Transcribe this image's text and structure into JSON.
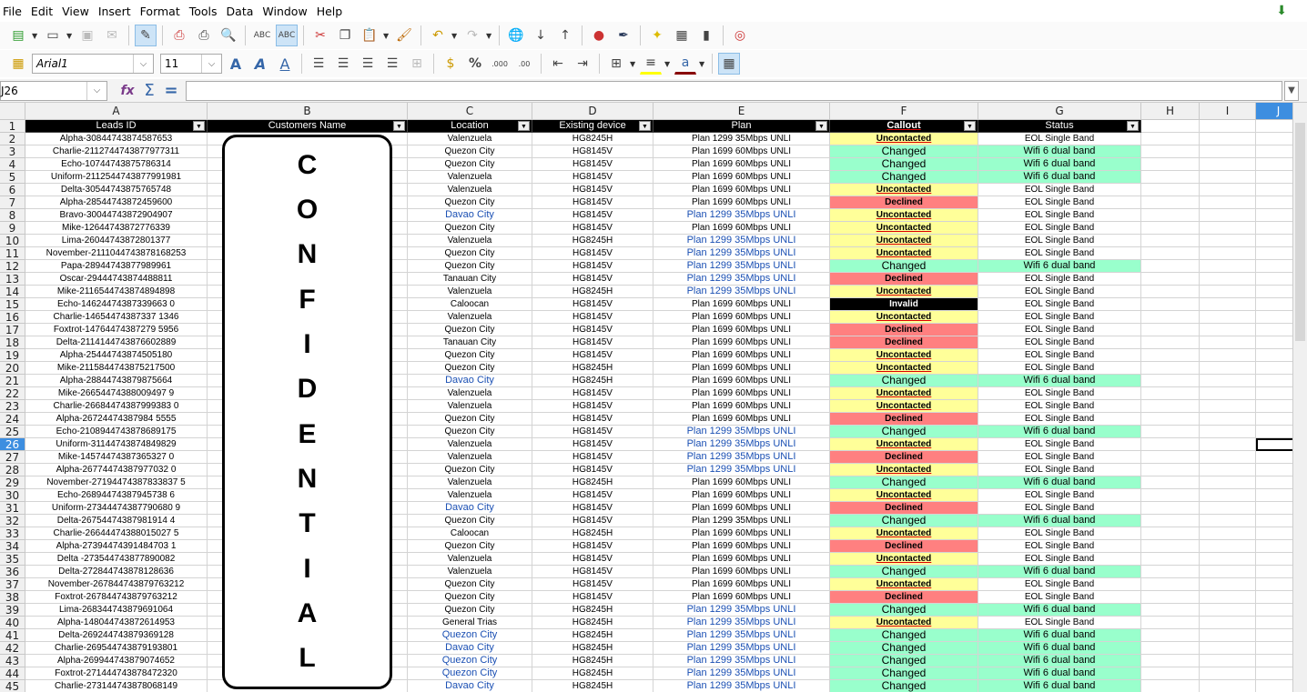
{
  "menu": [
    "File",
    "Edit",
    "View",
    "Insert",
    "Format",
    "Tools",
    "Data",
    "Window",
    "Help"
  ],
  "font_name": "Arial1",
  "font_size": "11",
  "name_box": "J26",
  "formula": "",
  "columns": [
    "A",
    "B",
    "C",
    "D",
    "E",
    "F",
    "G",
    "H",
    "I",
    "J"
  ],
  "selected_cell": {
    "col": "J",
    "row": 26
  },
  "headers": [
    "Leads ID",
    "Customers Name",
    "Location",
    "Existing device",
    "Plan",
    "Callout",
    "Status"
  ],
  "watermark": "CONFIDENTIAL",
  "rows": [
    [
      "Alpha-30844743874587653",
      "Valenzuela",
      "HG8245H",
      "Plan 1299 35Mbps UNLI",
      "Uncontacted",
      "EOL Single Band"
    ],
    [
      "Charlie-2112744743877977311",
      "Quezon City",
      "HG8145V",
      "Plan 1699 60Mbps UNLI",
      "Changed",
      "Wifi 6 dual band"
    ],
    [
      "Echo-10744743875786314",
      "Quezon City",
      "HG8145V",
      "Plan 1699 60Mbps UNLI",
      "Changed",
      "Wifi 6 dual band"
    ],
    [
      "Uniform-2112544743877991981",
      "Valenzuela",
      "HG8145V",
      "Plan 1699 60Mbps UNLI",
      "Changed",
      "Wifi 6 dual band"
    ],
    [
      "Delta-30544743875765748",
      "Valenzuela",
      "HG8145V",
      "Plan 1699 60Mbps UNLI",
      "Uncontacted",
      "EOL Single Band"
    ],
    [
      "Alpha-28544743872459600",
      "Quezon City",
      "HG8145V",
      "Plan 1699 60Mbps UNLI",
      "Declined",
      "EOL Single Band"
    ],
    [
      "Bravo-30044743872904907",
      "Davao City",
      "HG8145V",
      "Plan 1299 35Mbps UNLI",
      "Uncontacted",
      "EOL Single Band"
    ],
    [
      "Mike-12644743872776339",
      "Quezon City",
      "HG8145V",
      "Plan 1699 60Mbps UNLI",
      "Uncontacted",
      "EOL Single Band"
    ],
    [
      "Lima-26044743872801377",
      "Valenzuela",
      "HG8245H",
      "Plan 1299 35Mbps UNLI",
      "Uncontacted",
      "EOL Single Band"
    ],
    [
      "November-2111044743878168253",
      "Quezon City",
      "HG8145V",
      "Plan 1299 35Mbps UNLI",
      "Uncontacted",
      "EOL Single Band"
    ],
    [
      "Papa-28944743877989961",
      "Quezon City",
      "HG8145V",
      "Plan 1299 35Mbps UNLI",
      "Changed",
      "Wifi 6 dual band"
    ],
    [
      "Oscar-29444743874488811",
      "Tanauan City",
      "HG8145V",
      "Plan 1299 35Mbps UNLI",
      "Declined",
      "EOL Single Band"
    ],
    [
      "Mike-2116544743874894898",
      "Valenzuela",
      "HG8245H",
      "Plan 1299 35Mbps UNLI",
      "Uncontacted",
      "EOL Single Band"
    ],
    [
      "Echo-14624474387339663 0",
      "Caloocan",
      "HG8145V",
      "Plan 1699 60Mbps UNLI",
      "Invalid",
      "EOL Single Band"
    ],
    [
      "Charlie-14654474387337 1346",
      "Valenzuela",
      "HG8145V",
      "Plan 1699 60Mbps UNLI",
      "Uncontacted",
      "EOL Single Band"
    ],
    [
      "Foxtrot-14764474387279 5956",
      "Quezon City",
      "HG8145V",
      "Plan 1699 60Mbps UNLI",
      "Declined",
      "EOL Single Band"
    ],
    [
      "Delta-2114144743876602889",
      "Tanauan City",
      "HG8145V",
      "Plan 1699 60Mbps UNLI",
      "Declined",
      "EOL Single Band"
    ],
    [
      "Alpha-25444743874505180",
      "Quezon City",
      "HG8145V",
      "Plan 1699 60Mbps UNLI",
      "Uncontacted",
      "EOL Single Band"
    ],
    [
      "Mike-2115844743875217500",
      "Quezon City",
      "HG8245H",
      "Plan 1699 60Mbps UNLI",
      "Uncontacted",
      "EOL Single Band"
    ],
    [
      "Alpha-28844743879875664",
      "Davao City",
      "HG8245H",
      "Plan 1699 60Mbps UNLI",
      "Changed",
      "Wifi 6 dual band"
    ],
    [
      "Mike-26654474388009497 9",
      "Valenzuela",
      "HG8145V",
      "Plan 1699 60Mbps UNLI",
      "Uncontacted",
      "EOL Single Band"
    ],
    [
      "Charlie-26684474387999383 0",
      "Valenzuela",
      "HG8145V",
      "Plan 1699 60Mbps UNLI",
      "Uncontacted",
      "EOL Single Band"
    ],
    [
      "Alpha-26724474387984 5555",
      "Quezon City",
      "HG8145V",
      "Plan 1699 60Mbps UNLI",
      "Declined",
      "EOL Single Band"
    ],
    [
      "Echo-2108944743878689175",
      "Quezon City",
      "HG8145V",
      "Plan 1299 35Mbps UNLI",
      "Changed",
      "Wifi 6 dual band"
    ],
    [
      "Uniform-31144743874849829",
      "Valenzuela",
      "HG8145V",
      "Plan 1299 35Mbps UNLI",
      "Uncontacted",
      "EOL Single Band"
    ],
    [
      "Mike-14574474387365327 0",
      "Valenzuela",
      "HG8145V",
      "Plan 1299 35Mbps UNLI",
      "Declined",
      "EOL Single Band"
    ],
    [
      "Alpha-26774474387977032 0",
      "Quezon City",
      "HG8145V",
      "Plan 1299 35Mbps UNLI",
      "Uncontacted",
      "EOL Single Band"
    ],
    [
      "November-27194474387833837 5",
      "Valenzuela",
      "HG8245H",
      "Plan 1699 60Mbps UNLI",
      "Changed",
      "Wifi 6 dual band"
    ],
    [
      "Echo-26894474387945738 6",
      "Valenzuela",
      "HG8145V",
      "Plan 1699 60Mbps UNLI",
      "Uncontacted",
      "EOL Single Band"
    ],
    [
      "Uniform-27344474387790680 9",
      "Davao City",
      "HG8145V",
      "Plan 1699 60Mbps UNLI",
      "Declined",
      "EOL Single Band"
    ],
    [
      "Delta-26754474387981914 4",
      "Quezon City",
      "HG8145V",
      "Plan 1299 35Mbps UNLI",
      "Changed",
      "Wifi 6 dual band"
    ],
    [
      "Charlie-26644474388015027 5",
      "Caloocan",
      "HG8245H",
      "Plan 1699 60Mbps UNLI",
      "Uncontacted",
      "EOL Single Band"
    ],
    [
      "Alpha-27394474391484703 1",
      "Quezon City",
      "HG8145V",
      "Plan 1699 60Mbps UNLI",
      "Declined",
      "EOL Single Band"
    ],
    [
      "Delta -273544743877890082",
      "Valenzuela",
      "HG8145V",
      "Plan 1699 60Mbps UNLI",
      "Uncontacted",
      "EOL Single Band"
    ],
    [
      "Delta-272844743878128636",
      "Valenzuela",
      "HG8145V",
      "Plan 1699 60Mbps UNLI",
      "Changed",
      "Wifi 6 dual band"
    ],
    [
      "November-267844743879763212",
      "Quezon City",
      "HG8145V",
      "Plan 1699 60Mbps UNLI",
      "Uncontacted",
      "EOL Single Band"
    ],
    [
      "Foxtrot-267844743879763212",
      "Quezon City",
      "HG8145V",
      "Plan 1699 60Mbps UNLI",
      "Declined",
      "EOL Single Band"
    ],
    [
      "Lima-268344743879691064",
      "Quezon City",
      "HG8245H",
      "Plan 1299 35Mbps UNLI",
      "Changed",
      "Wifi 6 dual band"
    ],
    [
      "Alpha-148044743872614953",
      "General Trias",
      "HG8245H",
      "Plan 1299 35Mbps UNLI",
      "Uncontacted",
      "EOL Single Band"
    ],
    [
      "Delta-269244743879369128",
      "Quezon City",
      "HG8245H",
      "Plan 1299 35Mbps UNLI",
      "Changed",
      "Wifi 6 dual band"
    ],
    [
      "Charlie-269544743879193801",
      "Davao City",
      "HG8245H",
      "Plan 1299 35Mbps UNLI",
      "Changed",
      "Wifi 6 dual band"
    ],
    [
      "Alpha-269944743879074652",
      "Quezon City",
      "HG8245H",
      "Plan 1299 35Mbps UNLI",
      "Changed",
      "Wifi 6 dual band"
    ],
    [
      "Foxtrot-271444743878472320",
      "Quezon City",
      "HG8245H",
      "Plan 1299 35Mbps UNLI",
      "Changed",
      "Wifi 6 dual band"
    ],
    [
      "Charlie-273144743878068149",
      "Davao City",
      "HG8245H",
      "Plan 1299 35Mbps UNLI",
      "Changed",
      "Wifi 6 dual band"
    ]
  ]
}
